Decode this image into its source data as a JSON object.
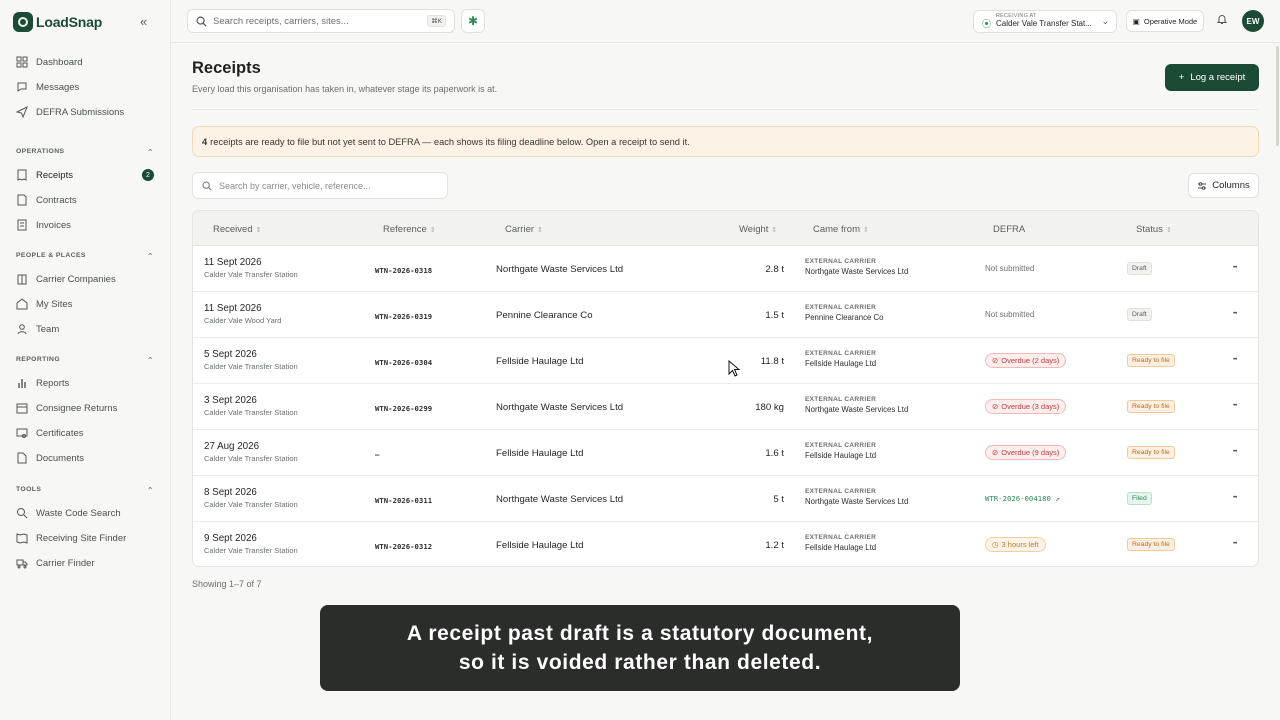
{
  "app": {
    "name": "LoadSnap"
  },
  "sidebar": {
    "top_items": [
      {
        "label": "Dashboard",
        "icon": "grid-icon"
      },
      {
        "label": "Messages",
        "icon": "chat-icon"
      },
      {
        "label": "DEFRA Submissions",
        "icon": "send-icon"
      }
    ],
    "sections": [
      {
        "title": "OPERATIONS",
        "items": [
          {
            "label": "Receipts",
            "icon": "receipt-icon",
            "badge": "2"
          },
          {
            "label": "Contracts",
            "icon": "document-icon"
          },
          {
            "label": "Invoices",
            "icon": "invoice-icon"
          }
        ]
      },
      {
        "title": "PEOPLE & PLACES",
        "items": [
          {
            "label": "Carrier Companies",
            "icon": "building-icon"
          },
          {
            "label": "My Sites",
            "icon": "site-icon"
          },
          {
            "label": "Team",
            "icon": "people-icon"
          }
        ]
      },
      {
        "title": "REPORTING",
        "items": [
          {
            "label": "Reports",
            "icon": "bar-chart-icon"
          },
          {
            "label": "Consignee Returns",
            "icon": "calendar-icon"
          },
          {
            "label": "Certificates",
            "icon": "certificate-icon"
          },
          {
            "label": "Documents",
            "icon": "file-icon"
          }
        ]
      },
      {
        "title": "TOOLS",
        "items": [
          {
            "label": "Waste Code Search",
            "icon": "search-icon"
          },
          {
            "label": "Receiving Site Finder",
            "icon": "map-icon"
          },
          {
            "label": "Carrier Finder",
            "icon": "truck-icon"
          }
        ]
      }
    ]
  },
  "topbar": {
    "search_placeholder": "Search receipts, carriers, sites...",
    "shortcut": "⌘K",
    "receiving_label": "RECEIVING AT",
    "receiving_site": "Calder Vale Transfer Stat...",
    "mode_label": "Operative Mode",
    "avatar_initials": "EW"
  },
  "main": {
    "title": "Receipts",
    "subtitle": "Every load this organisation has taken in, whatever stage its paperwork is at.",
    "log_button": "Log a receipt",
    "banner": {
      "count": "4",
      "text": "receipts are ready to file but not yet sent to DEFRA — each shows its filing deadline below. Open a receipt to send it."
    },
    "table_search_placeholder": "Search by carrier, vehicle, reference...",
    "columns_button": "Columns",
    "columns": [
      "Received",
      "Reference",
      "Carrier",
      "Weight",
      "Came from",
      "DEFRA",
      "Status"
    ],
    "rows": [
      {
        "date": "11 Sept 2026",
        "site": "Calder Vale Transfer Station",
        "ref": "WTN-2026-0318",
        "carrier": "Northgate Waste Services Ltd",
        "weight": "2.8 t",
        "from_label": "EXTERNAL CARRIER",
        "from": "Northgate Waste Services Ltd",
        "defra_type": "none",
        "defra": "Not submitted",
        "status_type": "draft",
        "status": "Draft"
      },
      {
        "date": "11 Sept 2026",
        "site": "Calder Vale Wood Yard",
        "ref": "WTN-2026-0319",
        "carrier": "Pennine Clearance Co",
        "weight": "1.5 t",
        "from_label": "EXTERNAL CARRIER",
        "from": "Pennine Clearance Co",
        "defra_type": "none",
        "defra": "Not submitted",
        "status_type": "draft",
        "status": "Draft"
      },
      {
        "date": "5 Sept 2026",
        "site": "Calder Vale Transfer Station",
        "ref": "WTN-2026-0304",
        "carrier": "Fellside Haulage Ltd",
        "weight": "11.8 t",
        "from_label": "EXTERNAL CARRIER",
        "from": "Fellside Haulage Ltd",
        "defra_type": "overdue",
        "defra": "Overdue (2 days)",
        "status_type": "ready",
        "status": "Ready to file"
      },
      {
        "date": "3 Sept 2026",
        "site": "Calder Vale Transfer Station",
        "ref": "WTN-2026-0299",
        "carrier": "Northgate Waste Services Ltd",
        "weight": "180 kg",
        "from_label": "EXTERNAL CARRIER",
        "from": "Northgate Waste Services Ltd",
        "defra_type": "overdue",
        "defra": "Overdue (3 days)",
        "status_type": "ready",
        "status": "Ready to file"
      },
      {
        "date": "27 Aug 2026",
        "site": "Calder Vale Transfer Station",
        "ref": "—",
        "carrier": "Fellside Haulage Ltd",
        "weight": "1.6 t",
        "from_label": "EXTERNAL CARRIER",
        "from": "Fellside Haulage Ltd",
        "defra_type": "overdue",
        "defra": "Overdue (9 days)",
        "status_type": "ready",
        "status": "Ready to file"
      },
      {
        "date": "8 Sept 2026",
        "site": "Calder Vale Transfer Station",
        "ref": "WTN-2026-0311",
        "carrier": "Northgate Waste Services Ltd",
        "weight": "5 t",
        "from_label": "EXTERNAL CARRIER",
        "from": "Northgate Waste Services Ltd",
        "defra_type": "filed",
        "defra": "WTR-2026-004180 ↗",
        "status_type": "filed",
        "status": "Filed"
      },
      {
        "date": "9 Sept 2026",
        "site": "Calder Vale Transfer Station",
        "ref": "WTN-2026-0312",
        "carrier": "Fellside Haulage Ltd",
        "weight": "1.2 t",
        "from_label": "EXTERNAL CARRIER",
        "from": "Fellside Haulage Ltd",
        "defra_type": "timeleft",
        "defra": "3 hours left",
        "status_type": "ready",
        "status": "Ready to file"
      }
    ],
    "showing": "Showing 1–7 of 7"
  },
  "caption": {
    "line1": "A receipt past draft is a statutory document,",
    "line2": "so it is voided rather than deleted."
  },
  "colors": {
    "brand": "#1c4b35",
    "overdue": "#c73a3a",
    "ready": "#c36a1a",
    "filed": "#2e8a55"
  }
}
